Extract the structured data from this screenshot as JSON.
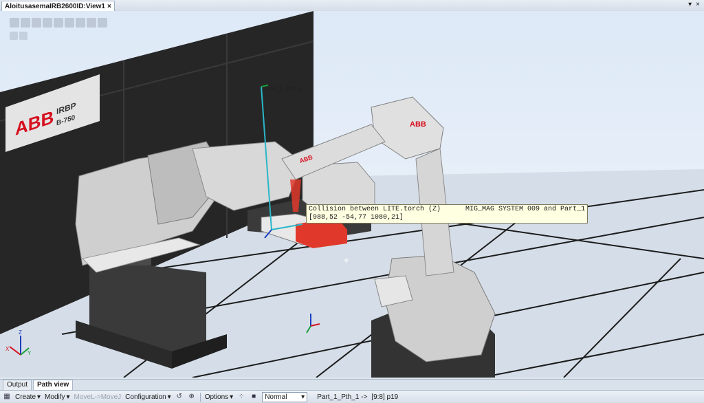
{
  "document_tab": {
    "title": "AloitusasemaIRB2600ID:View1",
    "close": "×"
  },
  "window_controls": {
    "dropdown": "▾",
    "close": "×"
  },
  "scene": {
    "positioner_brand": "ABB",
    "positioner_model_line1": "IRBP",
    "positioner_model_line2": "B-750",
    "robot_brand": "ABB",
    "path_label": "Part_1_Pth_1",
    "colors": {
      "collision": "#e0392b",
      "floor": "#d3dde7",
      "robot": "#e2e2e2",
      "dark": "#262626",
      "path": "#2ab7c9"
    }
  },
  "collision": {
    "line1": "Collision between LITE.torch (Z)      MIG_MAG SYSTEM 009 and Part_1",
    "line2_prefix": "[988,52 ",
    "line2_highlight": "-54",
    "line2_suffix": ",77 1080,21]"
  },
  "output_tabs": [
    {
      "label": "Output"
    },
    {
      "label": "Path view"
    }
  ],
  "bottom_toolbar": {
    "create": "Create",
    "modify": "Modify",
    "movel": "MoveL->MoveJ",
    "configuration": "Configuration",
    "options": "Options",
    "speed": "Normal",
    "path_status": "Part_1_Pth_1 ->",
    "path_position": "[9:8] p19",
    "arrow": "▾"
  }
}
